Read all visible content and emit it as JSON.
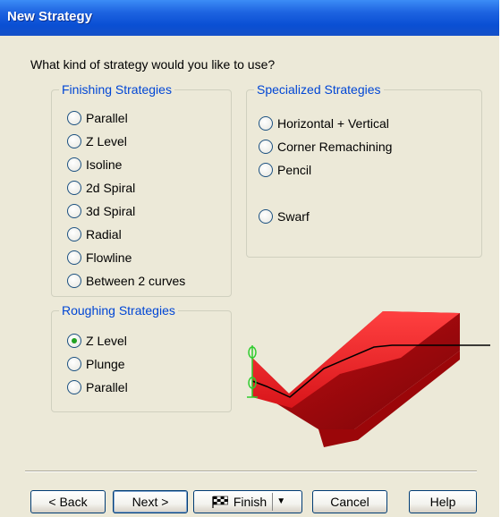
{
  "window": {
    "title": "New Strategy"
  },
  "question": "What kind of strategy would you like to use?",
  "finishing": {
    "legend": "Finishing Strategies",
    "options": [
      "Parallel",
      "Z Level",
      "Isoline",
      "2d Spiral",
      "3d Spiral",
      "Radial",
      "Flowline",
      "Between 2 curves"
    ],
    "selected": null
  },
  "specialized": {
    "legend": "Specialized Strategies",
    "options": [
      "Horizontal + Vertical",
      "Corner Remachining",
      "Pencil",
      "Swarf"
    ],
    "selected": null
  },
  "roughing": {
    "legend": "Roughing Strategies",
    "options": [
      "Z Level",
      "Plunge",
      "Parallel"
    ],
    "selected": "Z Level"
  },
  "buttons": {
    "back": "< Back",
    "next": "Next >",
    "finish": "Finish",
    "cancel": "Cancel",
    "help": "Help"
  },
  "colors": {
    "title_bar": "#0a4fd4",
    "group_legend": "#0046d5",
    "preview_shape": "#d8151a",
    "preview_axes": "#2ecc2e"
  }
}
